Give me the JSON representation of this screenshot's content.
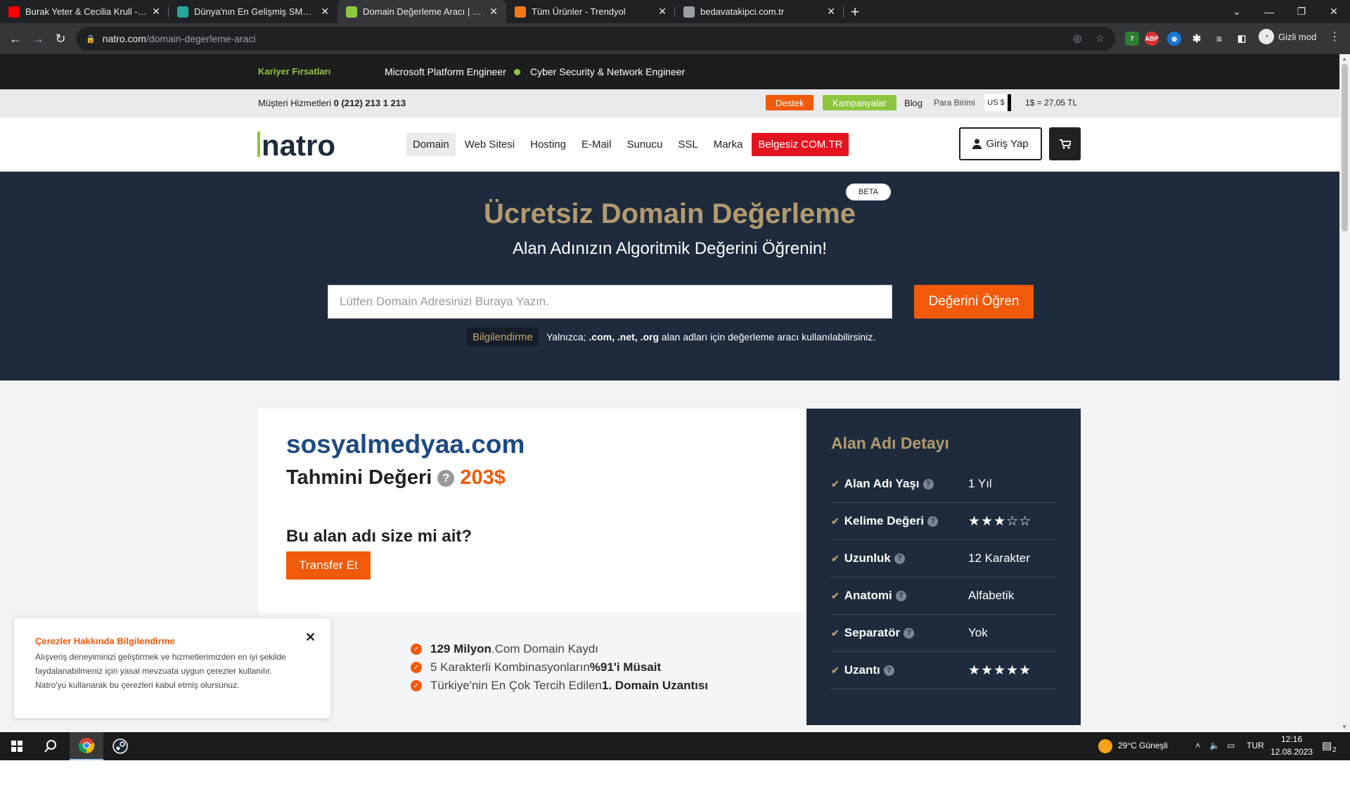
{
  "browser": {
    "tabs": [
      {
        "title": "Burak Yeter & Cecilia Krull - My Life Is Going On",
        "favicon": "youtube-icon",
        "color": "#ff0000"
      },
      {
        "title": "Dünya'nın En Gelişmiş SMMPanel",
        "favicon": "smm-icon",
        "color": "#26a69a"
      },
      {
        "title": "Domain Değerleme Aracı | Domain",
        "favicon": "natro-icon",
        "color": "#8cc63f"
      },
      {
        "title": "Tüm Ürünler - Trendyol",
        "favicon": "trendyol-icon",
        "color": "#f27a1a"
      },
      {
        "title": "bedavatakipci.com.tr",
        "favicon": "globe-icon",
        "color": "#9aa0a6"
      }
    ],
    "url_host": "natro.com",
    "url_path": "/domain-degerleme-araci",
    "profile_label": "Gizli mod",
    "ext_abp": "ABP",
    "ext_badge": "7"
  },
  "careers": {
    "label": "Kariyer Fırsatları",
    "job1": "Microsoft Platform Engineer",
    "job2": "Cyber Security & Network Engineer"
  },
  "infobar": {
    "phone_label": "Müşteri Hizmetleri ",
    "phone": "0 (212) 213 1 213",
    "support": "Destek",
    "campaigns": "Kampanyalar",
    "blog": "Blog",
    "currency_label": "Para Birimi",
    "currency": "US $",
    "rate": "1$ = 27,05 TL",
    "support_color": "#f05a0a",
    "campaigns_color": "#8cc63f"
  },
  "nav": {
    "logo": "natro",
    "items": [
      "Domain",
      "Web Sitesi",
      "Hosting",
      "E-Mail",
      "Sunucu",
      "SSL",
      "Marka"
    ],
    "promo": "Belgesiz COM.TR",
    "login": "Giriş Yap"
  },
  "hero": {
    "badge": "BETA",
    "title": "Ücretsiz Domain Değerleme",
    "subtitle": "Alan Adınızın Algoritmik Değerini Öğrenin!",
    "placeholder": "Lütfen Domain Adresinizi Buraya Yazın.",
    "button": "Değerini Öğren",
    "info_label": "Bilgilendirme",
    "info_pre": "Yalnızca; ",
    "info_exts": ".com, .net, .org",
    "info_post": " alan adları için değerleme aracı kullanılabilirsiniz."
  },
  "result": {
    "domain": "sosyalmedyaa.com",
    "value_label": "Tahmini Değeri",
    "price": "203$",
    "own_q": "Bu alan adı size mi ait?",
    "transfer": "Transfer Et",
    "features": [
      {
        "b": "129 Milyon",
        "t": " .Com Domain Kaydı",
        "order": "bt"
      },
      {
        "b": "%91'i Müsait",
        "t": "5 Karakterli Kombinasyonların ",
        "order": "tb"
      },
      {
        "b": "1. Domain Uzantısı",
        "t": "Türkiye'nin En Çok Tercih Edilen ",
        "order": "tb"
      }
    ]
  },
  "detail": {
    "title": "Alan Adı Detayı",
    "rows": [
      {
        "key": "Alan Adı Yaşı",
        "value": "1 Yıl"
      },
      {
        "key": "Kelime Değeri",
        "stars": 3,
        "value": ""
      },
      {
        "key": "Uzunluk",
        "value": "12 Karakter"
      },
      {
        "key": "Anatomi",
        "value": "Alfabetik"
      },
      {
        "key": "Separatör",
        "value": "Yok"
      },
      {
        "key": "Uzantı",
        "stars": 5,
        "value": ""
      }
    ]
  },
  "cookie": {
    "title": "Çerezler Hakkında Bilgilendirme",
    "body": "Alışveriş deneyiminizi geliştirmek ve hizmetlerimizden en iyi şekilde faydalanabilmeniz için yasal mevzuata uygun çerezler kullanılır. Natro'yu kullanarak bu çerezleri kabul etmiş olursunuz."
  },
  "taskbar": {
    "weather": "29°C  Güneşli",
    "lang": "TUR",
    "time": "12:16",
    "date": "12.08.2023",
    "notif": "2"
  },
  "colors": {
    "accent": "#f05a0a",
    "navy": "#1e2b3c",
    "gold": "#b39a6e",
    "brand_green": "#8cc63f"
  }
}
